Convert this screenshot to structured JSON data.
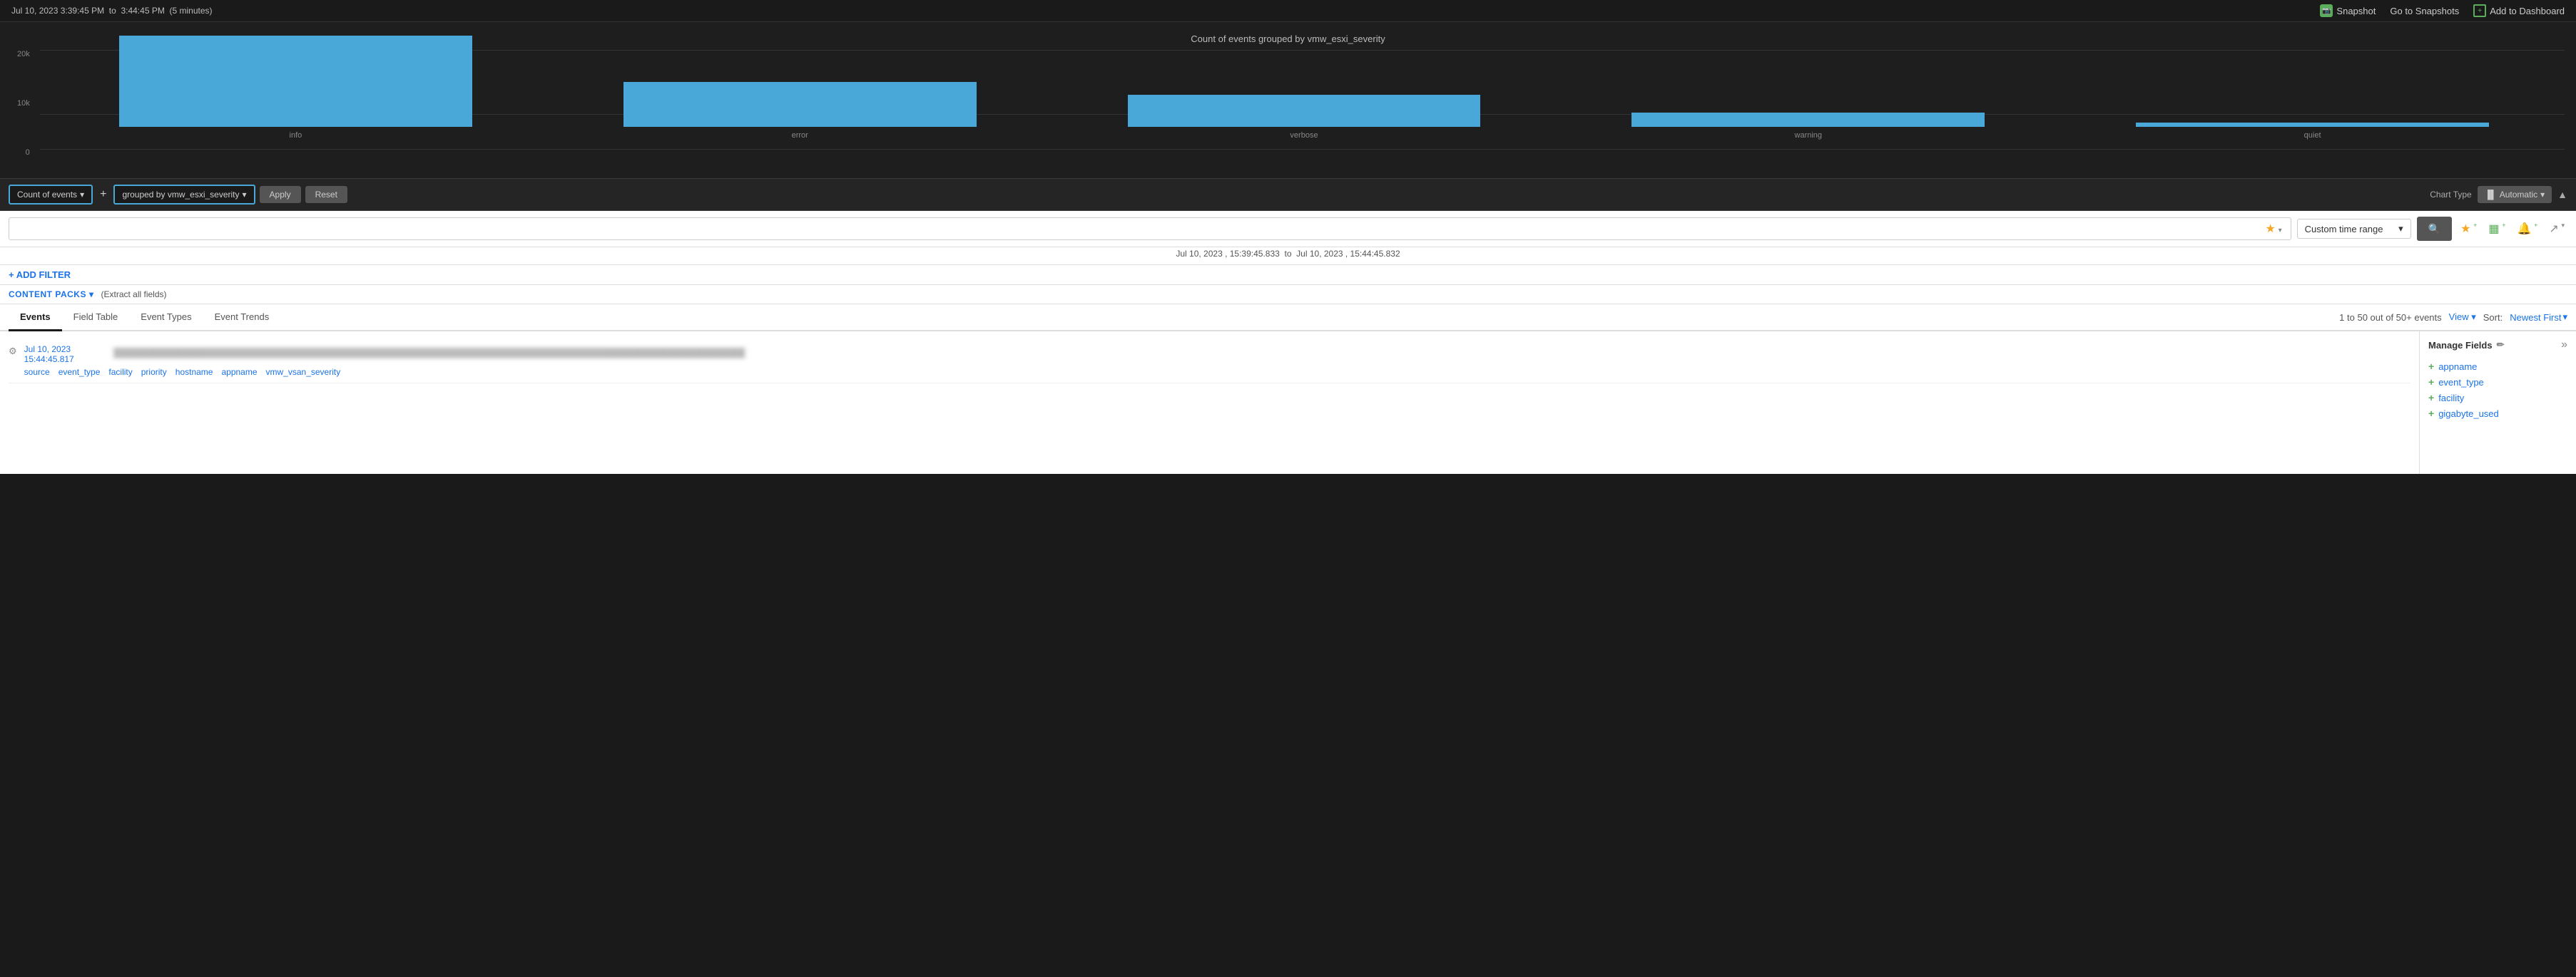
{
  "topbar": {
    "time_range": "Jul 10, 2023  3:39:45 PM",
    "time_to": "3:44:45 PM",
    "time_duration": "(5 minutes)",
    "snapshot_label": "Snapshot",
    "go_to_snapshots_label": "Go to Snapshots",
    "add_to_dashboard_label": "Add to Dashboard"
  },
  "chart": {
    "title": "Count of events grouped by vmw_esxi_severity",
    "y_labels": [
      "20k",
      "10k",
      "0"
    ],
    "bars": [
      {
        "label": "info",
        "height_pct": 85
      },
      {
        "label": "error",
        "height_pct": 42
      },
      {
        "label": "verbose",
        "height_pct": 30
      },
      {
        "label": "warning",
        "height_pct": 10
      },
      {
        "label": "quiet",
        "height_pct": 3
      }
    ]
  },
  "query": {
    "metric_label": "Count of events",
    "metric_caret": "▾",
    "plus_label": "+",
    "group_label": "grouped by vmw_esxi_severity",
    "group_caret": "▾",
    "apply_label": "Apply",
    "reset_label": "Reset",
    "chart_type_label": "Chart Type",
    "chart_type_value": "Automatic",
    "chart_type_caret": "▾",
    "collapse_icon": "▲"
  },
  "search": {
    "placeholder": "",
    "time_range_label": "Custom time range",
    "time_from": "Jul 10, 2023 , 15:39:45.833",
    "time_to_label": "to",
    "time_to": "Jul 10, 2023 , 15:44:45.832",
    "search_icon": "🔍"
  },
  "actions": {
    "add_filter_label": "+ ADD FILTER",
    "content_packs_label": "CONTENT PACKS",
    "extract_fields_label": "(Extract all fields)"
  },
  "tabs": {
    "items": [
      {
        "label": "Events",
        "active": true
      },
      {
        "label": "Field Table",
        "active": false
      },
      {
        "label": "Event Types",
        "active": false
      },
      {
        "label": "Event Trends",
        "active": false
      }
    ],
    "results_text": "1 to 50 out of 50+ events",
    "view_label": "View",
    "sort_label": "Sort:",
    "sort_value": "Newest First"
  },
  "event": {
    "timestamp_line1": "Jul 10, 2023",
    "timestamp_line2": "15:44:45.817",
    "text_blurred": "████████████████████████████████████████████████████████████████████████████████",
    "fields": [
      "source",
      "event_type",
      "facility",
      "priority",
      "hostname",
      "appname",
      "vmw_vsan_severity"
    ]
  },
  "manage_fields": {
    "title": "Manage Fields",
    "fields": [
      "appname",
      "event_type",
      "facility",
      "gigabyte_used"
    ]
  }
}
